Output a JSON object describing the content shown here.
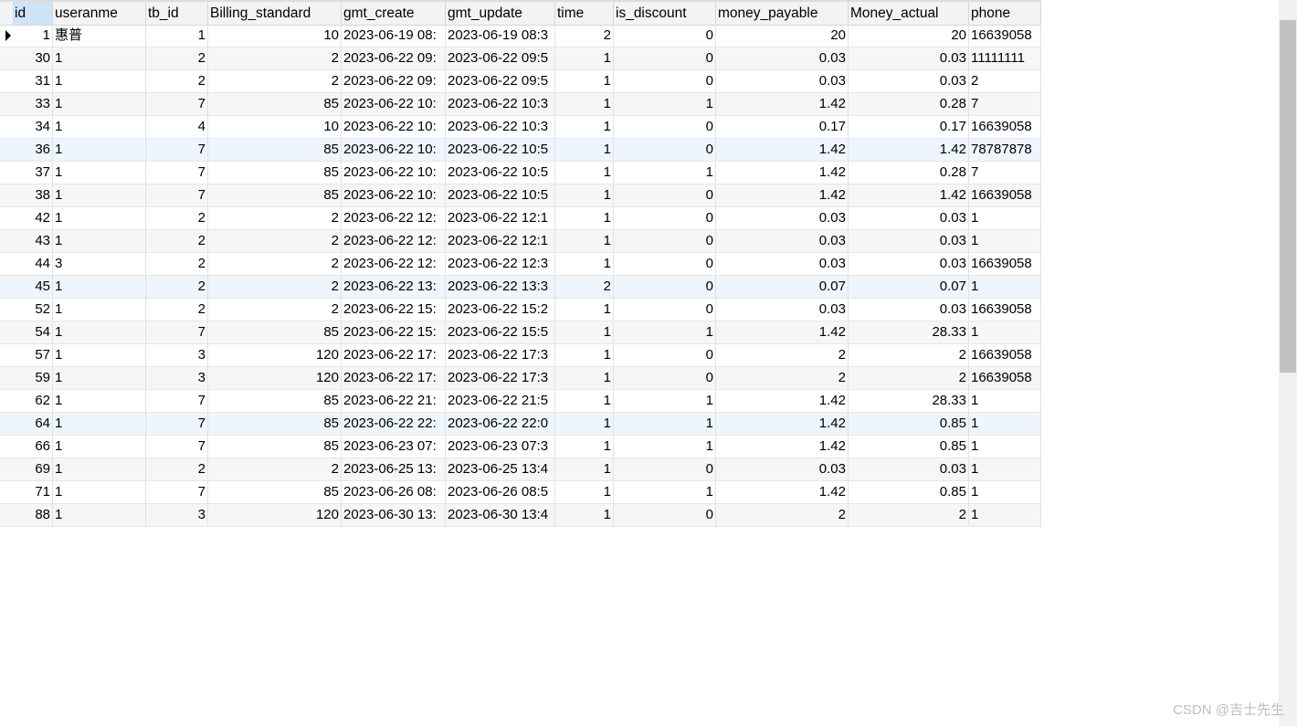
{
  "table": {
    "columns": [
      {
        "label": "id",
        "sorted": true
      },
      {
        "label": "useranme",
        "sorted": false
      },
      {
        "label": "tb_id",
        "sorted": false
      },
      {
        "label": "Billing_standard",
        "sorted": false
      },
      {
        "label": "gmt_create",
        "sorted": false
      },
      {
        "label": "gmt_update",
        "sorted": false
      },
      {
        "label": "time",
        "sorted": false
      },
      {
        "label": "is_discount",
        "sorted": false
      },
      {
        "label": "money_payable",
        "sorted": false
      },
      {
        "label": "Money_actual",
        "sorted": false
      },
      {
        "label": "phone",
        "sorted": false
      }
    ],
    "current_row": 0,
    "highlighted_rows": [
      5,
      11,
      17
    ],
    "rows": [
      [
        "1",
        "惠普",
        "1",
        "10",
        "2023-06-19 08:",
        "2023-06-19 08:3",
        "2",
        "0",
        "20",
        "20",
        "16639058"
      ],
      [
        "30",
        "1",
        "2",
        "2",
        "2023-06-22 09:",
        "2023-06-22 09:5",
        "1",
        "0",
        "0.03",
        "0.03",
        "11111111"
      ],
      [
        "31",
        "1",
        "2",
        "2",
        "2023-06-22 09:",
        "2023-06-22 09:5",
        "1",
        "0",
        "0.03",
        "0.03",
        "2"
      ],
      [
        "33",
        "1",
        "7",
        "85",
        "2023-06-22 10:",
        "2023-06-22 10:3",
        "1",
        "1",
        "1.42",
        "0.28",
        "7"
      ],
      [
        "34",
        "1",
        "4",
        "10",
        "2023-06-22 10:",
        "2023-06-22 10:3",
        "1",
        "0",
        "0.17",
        "0.17",
        "16639058"
      ],
      [
        "36",
        "1",
        "7",
        "85",
        "2023-06-22 10:",
        "2023-06-22 10:5",
        "1",
        "0",
        "1.42",
        "1.42",
        "78787878"
      ],
      [
        "37",
        "1",
        "7",
        "85",
        "2023-06-22 10:",
        "2023-06-22 10:5",
        "1",
        "1",
        "1.42",
        "0.28",
        "7"
      ],
      [
        "38",
        "1",
        "7",
        "85",
        "2023-06-22 10:",
        "2023-06-22 10:5",
        "1",
        "0",
        "1.42",
        "1.42",
        "16639058"
      ],
      [
        "42",
        "1",
        "2",
        "2",
        "2023-06-22 12:",
        "2023-06-22 12:1",
        "1",
        "0",
        "0.03",
        "0.03",
        "1"
      ],
      [
        "43",
        "1",
        "2",
        "2",
        "2023-06-22 12:",
        "2023-06-22 12:1",
        "1",
        "0",
        "0.03",
        "0.03",
        "1"
      ],
      [
        "44",
        "3",
        "2",
        "2",
        "2023-06-22 12:",
        "2023-06-22 12:3",
        "1",
        "0",
        "0.03",
        "0.03",
        "16639058"
      ],
      [
        "45",
        "1",
        "2",
        "2",
        "2023-06-22 13:",
        "2023-06-22 13:3",
        "2",
        "0",
        "0.07",
        "0.07",
        "1"
      ],
      [
        "52",
        "1",
        "2",
        "2",
        "2023-06-22 15:",
        "2023-06-22 15:2",
        "1",
        "0",
        "0.03",
        "0.03",
        "16639058"
      ],
      [
        "54",
        "1",
        "7",
        "85",
        "2023-06-22 15:",
        "2023-06-22 15:5",
        "1",
        "1",
        "1.42",
        "28.33",
        "1"
      ],
      [
        "57",
        "1",
        "3",
        "120",
        "2023-06-22 17:",
        "2023-06-22 17:3",
        "1",
        "0",
        "2",
        "2",
        "16639058"
      ],
      [
        "59",
        "1",
        "3",
        "120",
        "2023-06-22 17:",
        "2023-06-22 17:3",
        "1",
        "0",
        "2",
        "2",
        "16639058"
      ],
      [
        "62",
        "1",
        "7",
        "85",
        "2023-06-22 21:",
        "2023-06-22 21:5",
        "1",
        "1",
        "1.42",
        "28.33",
        "1"
      ],
      [
        "64",
        "1",
        "7",
        "85",
        "2023-06-22 22:",
        "2023-06-22 22:0",
        "1",
        "1",
        "1.42",
        "0.85",
        "1"
      ],
      [
        "66",
        "1",
        "7",
        "85",
        "2023-06-23 07:",
        "2023-06-23 07:3",
        "1",
        "1",
        "1.42",
        "0.85",
        "1"
      ],
      [
        "69",
        "1",
        "2",
        "2",
        "2023-06-25 13:",
        "2023-06-25 13:4",
        "1",
        "0",
        "0.03",
        "0.03",
        "1"
      ],
      [
        "71",
        "1",
        "7",
        "85",
        "2023-06-26 08:",
        "2023-06-26 08:5",
        "1",
        "1",
        "1.42",
        "0.85",
        "1"
      ],
      [
        "88",
        "1",
        "3",
        "120",
        "2023-06-30 13:",
        "2023-06-30 13:4",
        "1",
        "0",
        "2",
        "2",
        "1"
      ]
    ]
  },
  "watermark": "CSDN @吉士先生",
  "colors": {
    "sorted_header": "#cfe3f7",
    "row_highlight": "#eef5fc",
    "scrollbar_thumb": "#c1c1c1"
  }
}
